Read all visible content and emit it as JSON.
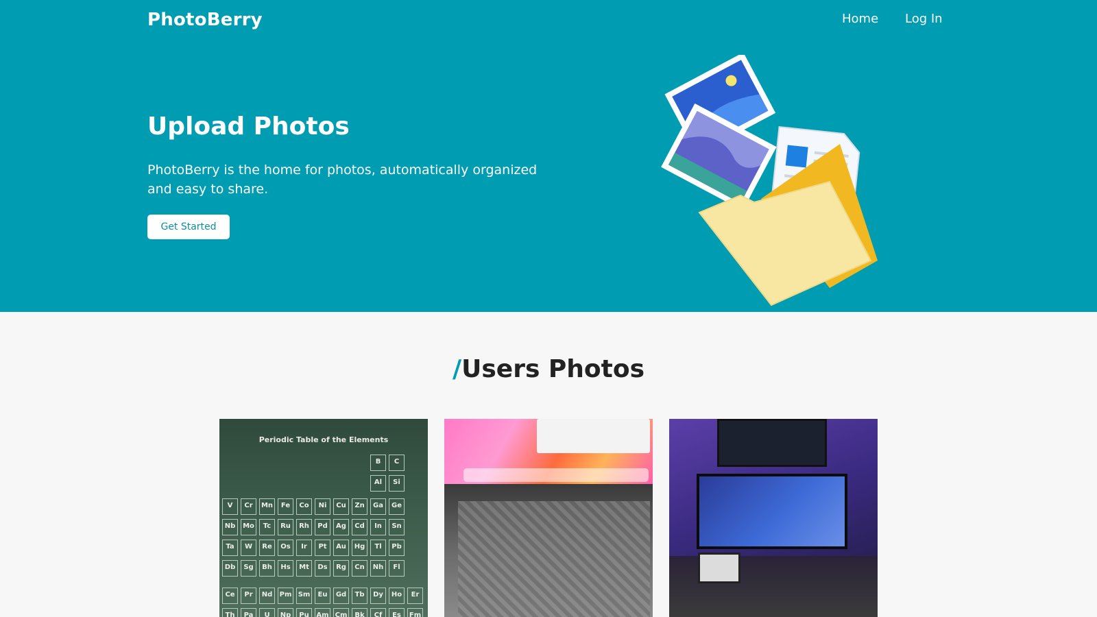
{
  "header": {
    "brand": "PhotoBerry",
    "nav": [
      {
        "label": "Home"
      },
      {
        "label": "Log In"
      }
    ]
  },
  "hero": {
    "title": "Upload Photos",
    "subtitle": "PhotoBerry is the home for photos, automatically organized and easy to share.",
    "cta_label": "Get Started"
  },
  "gallery": {
    "title_prefix": "/",
    "title": "Users Photos",
    "photos": [
      {
        "caption": "Periodic Table of the Elements"
      },
      {
        "caption": ""
      },
      {
        "caption": ""
      }
    ]
  },
  "periodic_symbols": [
    [
      "B",
      "C"
    ],
    [
      "Al",
      "Si"
    ],
    [
      "V",
      "Cr",
      "Mn",
      "Fe",
      "Co",
      "Ni",
      "Cu",
      "Zn",
      "Ga",
      "Ge"
    ],
    [
      "Nb",
      "Mo",
      "Tc",
      "Ru",
      "Rh",
      "Pd",
      "Ag",
      "Cd",
      "In",
      "Sn"
    ],
    [
      "Ta",
      "W",
      "Re",
      "Os",
      "Ir",
      "Pt",
      "Au",
      "Hg",
      "Tl",
      "Pb"
    ],
    [
      "Db",
      "Sg",
      "Bh",
      "Hs",
      "Mt",
      "Ds",
      "Rg",
      "Cn",
      "Nh",
      "Fl"
    ],
    [
      "Ce",
      "Pr",
      "Nd",
      "Pm",
      "Sm",
      "Eu",
      "Gd",
      "Tb",
      "Dy",
      "Ho",
      "Er"
    ],
    [
      "Th",
      "Pa",
      "U",
      "Np",
      "Pu",
      "Am",
      "Cm",
      "Bk",
      "Cf",
      "Es",
      "Fm"
    ]
  ],
  "colors": {
    "accent": "#009db2",
    "page_bg": "#f7f7f7"
  }
}
